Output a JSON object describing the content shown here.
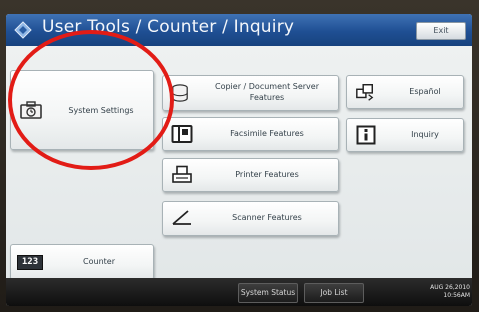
{
  "header": {
    "title": "User Tools / Counter / Inquiry",
    "exit_label": "Exit"
  },
  "buttons": {
    "system_settings": "System Settings",
    "copier_line1": "Copier / Document Server",
    "copier_line2": "Features",
    "facsimile": "Facsimile Features",
    "printer": "Printer Features",
    "scanner": "Scanner Features",
    "espanol": "Español",
    "inquiry": "Inquiry",
    "counter": "Counter",
    "counter_icon_text": "123"
  },
  "footer": {
    "system_status": "System Status",
    "job_list": "Job List",
    "date": "AUG  26,2010",
    "time": "10:56AM"
  },
  "colors": {
    "header": "#1f4f93",
    "annotation_circle": "#e21c16"
  },
  "icons": [
    "home-logo-icon",
    "toolbox-clock-icon",
    "copier-icon",
    "fax-icon",
    "printer-icon",
    "scanner-icon",
    "language-switch-icon",
    "info-icon",
    "counter-123-icon"
  ]
}
